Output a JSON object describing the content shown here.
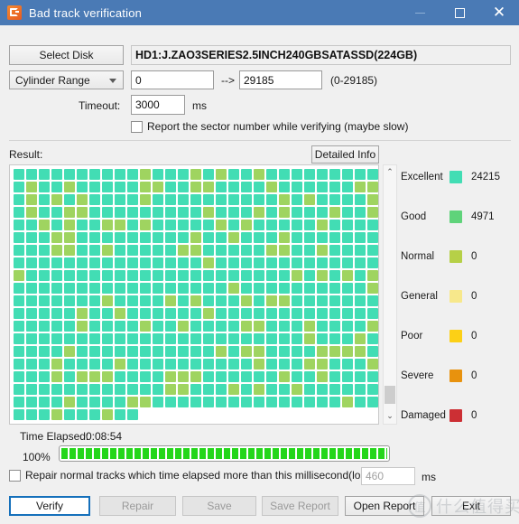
{
  "window": {
    "title": "Bad track verification",
    "icon": "app-icon",
    "minimize_label": "—",
    "maximize_label": "□",
    "close_label": "✕"
  },
  "disk": {
    "select_button": "Select Disk",
    "info": "HD1:J.ZAO3SERIES2.5INCH240GBSATASSD(224GB)"
  },
  "range": {
    "mode": "Cylinder Range",
    "from": "0",
    "to": "29185",
    "arrow": "-->",
    "hint": "(0-29185)"
  },
  "timeout": {
    "label": "Timeout:",
    "value": "3000",
    "unit": "ms"
  },
  "report_sector": {
    "label": "Report the sector number while verifying (maybe slow)",
    "checked": false
  },
  "result": {
    "label": "Result:",
    "detailed_info_button": "Detailed Info"
  },
  "legend": [
    {
      "name": "Excellent",
      "count": "24215",
      "color": "#42ddb4"
    },
    {
      "name": "Good",
      "count": "4971",
      "color": "#5fd37a"
    },
    {
      "name": "Normal",
      "count": "0",
      "color": "#b6d047"
    },
    {
      "name": "General",
      "count": "0",
      "color": "#f7e88b"
    },
    {
      "name": "Poor",
      "count": "0",
      "color": "#fcd016"
    },
    {
      "name": "Severe",
      "count": "0",
      "color": "#e8920e"
    },
    {
      "name": "Damaged",
      "count": "0",
      "color": "#cc2f34"
    }
  ],
  "grid": {
    "columns": 29,
    "full_rows": 19,
    "last_row_cells": 10,
    "good_ratio": 0.17,
    "excellent_color": "#42ddb4",
    "good_color": "#9fd460"
  },
  "scrollbar": {
    "up_arrow": "⌃",
    "down_arrow": "⌄"
  },
  "time_elapsed": {
    "label": "Time Elapsed:",
    "value": "0:08:54"
  },
  "progress": {
    "percent_label": "100%",
    "percent": 100,
    "color": "#24d61a"
  },
  "repair_option": {
    "label": "Repair normal tracks which time elapsed more than this millisecond(lossless):",
    "value": "460",
    "unit": "ms",
    "checked": false
  },
  "buttons": {
    "verify": "Verify",
    "repair": "Repair",
    "save": "Save",
    "save_report": "Save Report",
    "open_report": "Open Report",
    "exit": "Exit"
  },
  "watermark": {
    "mark": "值",
    "text": "什么值得买"
  }
}
